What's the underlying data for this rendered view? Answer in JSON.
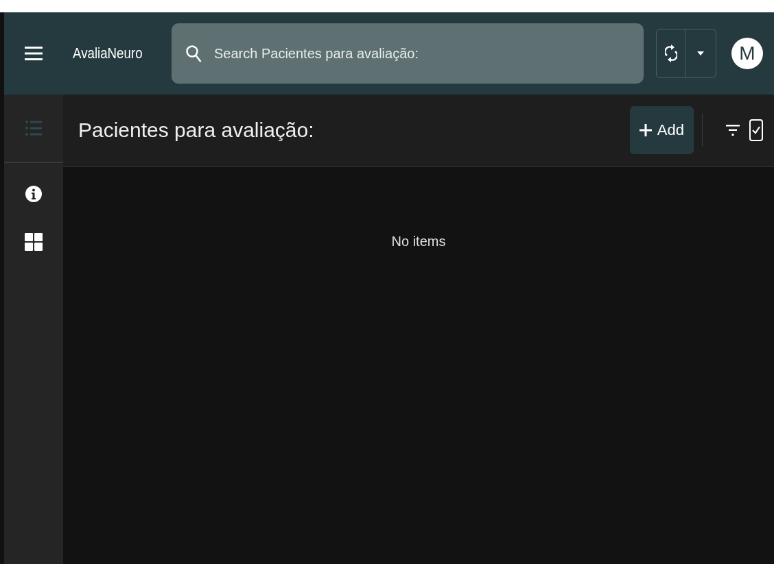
{
  "app_bar": {
    "title": "AvaliaNeuro",
    "search": {
      "placeholder": "Search Pacientes para avaliação:"
    },
    "avatar": "M"
  },
  "sidebar": {
    "items": [
      {
        "kind": "list",
        "selected": true
      },
      {
        "kind": "info",
        "selected": false
      },
      {
        "kind": "grid",
        "selected": false
      }
    ]
  },
  "panel": {
    "title": "Pacientes para avaliação:",
    "add_button": "Add",
    "empty_message": "No items"
  }
}
